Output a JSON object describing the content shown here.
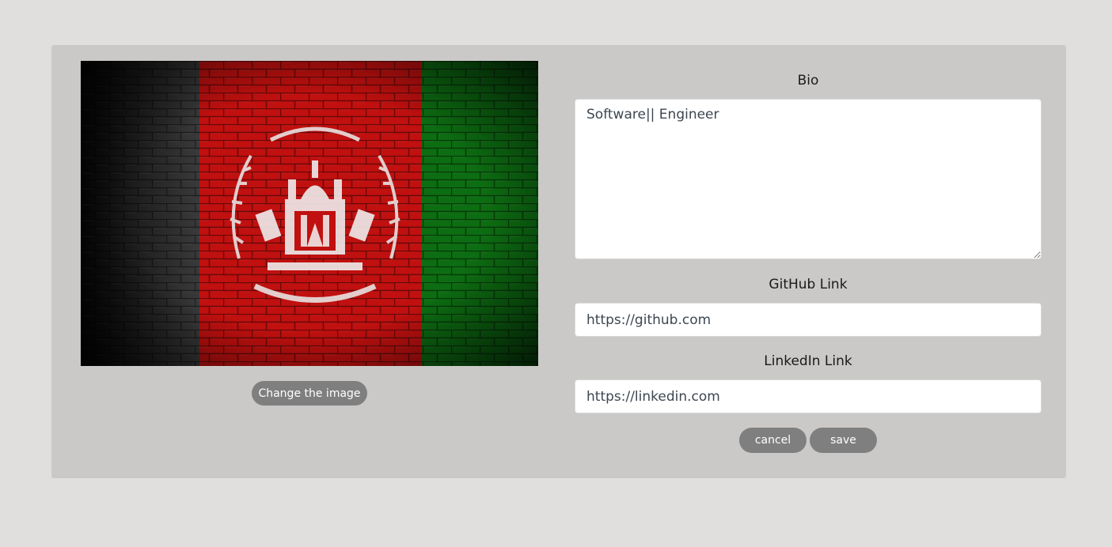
{
  "profile": {
    "image_alt_icon": "afghanistan-flag-brick-wall-image",
    "change_image_label": "Change the image"
  },
  "form": {
    "bio_label": "Bio",
    "bio_value": "Software|| Engineer",
    "github_label": "GitHub Link",
    "github_value": "https://github.com",
    "linkedin_label": "LinkedIn Link",
    "linkedin_value": "https://linkedin.com",
    "cancel_label": "cancel",
    "save_label": "save"
  },
  "colors": {
    "page_bg": "#e0dfdd",
    "card_bg": "#cac9c7",
    "button_bg": "#7f7f7f",
    "flag_black": "#1c1c1c",
    "flag_red": "#c0100f",
    "flag_green": "#0d6d12"
  }
}
